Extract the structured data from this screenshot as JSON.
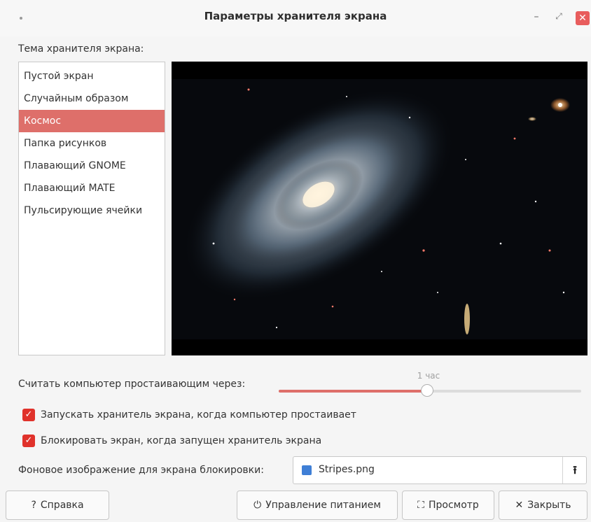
{
  "window": {
    "title": "Параметры хранителя экрана",
    "min_icon": "–",
    "max_icon": "⤢",
    "close_icon": "✕"
  },
  "themes": {
    "label": "Тема хранителя экрана:",
    "items": [
      "Пустой экран",
      "Случайным образом",
      "Космос",
      "Папка рисунков",
      "Плавающий GNOME",
      "Плавающий MATE",
      "Пульсирующие ячейки"
    ],
    "selected_index": 2
  },
  "idle": {
    "label": "Считать компьютер простаивающим через:",
    "value_text": "1 час",
    "fraction": 0.49
  },
  "options": {
    "activate_label": "Запускать хранитель экрана, когда компьютер простаивает",
    "lock_label": "Блокировать экран, когда запущен хранитель экрана",
    "check_icon": "✓"
  },
  "lock_background": {
    "label": "Фоновое изображение для экрана блокировки:",
    "file_name": "Stripes.png",
    "upload_icon": "⭱"
  },
  "buttons": {
    "help_icon": "?",
    "help": "Справка",
    "power_icon": "⏻",
    "power": "Управление питанием",
    "preview_icon": "⛶",
    "preview": "Просмотр",
    "close_icon": "✕",
    "close": "Закрыть"
  },
  "colors": {
    "accent": "#de6f6a",
    "checkbox": "#e0322b",
    "close_button": "#e85d5d"
  }
}
